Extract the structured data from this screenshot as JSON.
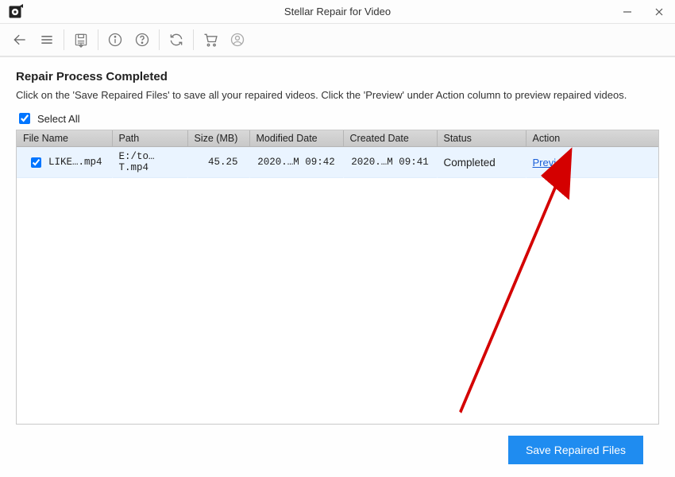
{
  "titlebar": {
    "title": "Stellar Repair for Video"
  },
  "toolbar_icons": {
    "back": "back-icon",
    "menu": "menu-icon",
    "save_disk": "save-disk-icon",
    "info": "info-icon",
    "help": "help-icon",
    "refresh": "refresh-icon",
    "cart": "cart-icon",
    "user": "user-icon"
  },
  "heading": "Repair Process Completed",
  "description": "Click on the 'Save Repaired Files' to save all your repaired videos. Click the 'Preview' under Action column to preview repaired videos.",
  "select_all_label": "Select All",
  "select_all_checked": true,
  "columns": {
    "file_name": "File Name",
    "path": "Path",
    "size": "Size (MB)",
    "modified": "Modified Date",
    "created": "Created Date",
    "status": "Status",
    "action": "Action"
  },
  "rows": [
    {
      "checked": true,
      "file_name": "LIKE….mp4",
      "path": "E:/to…T.mp4",
      "size": "45.25",
      "modified": "2020.…M 09:42",
      "created": "2020.…M 09:41",
      "status": "Completed",
      "action": "Preview"
    }
  ],
  "footer": {
    "save_button": "Save Repaired Files"
  }
}
